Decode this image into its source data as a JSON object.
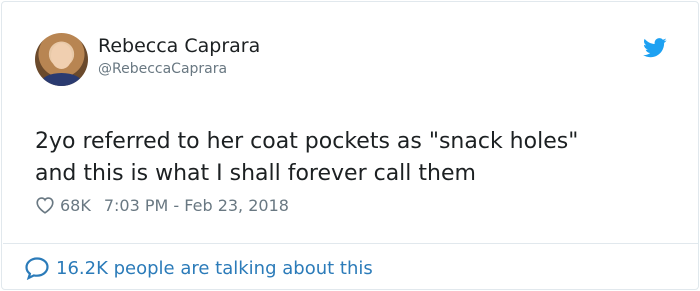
{
  "tweet": {
    "author": {
      "name": "Rebecca Caprara",
      "handle": "@RebeccaCaprara",
      "avatar_icon": "profile-photo"
    },
    "brand_icon": "twitter-bird-icon",
    "brand_color": "#1da1f2",
    "text_lines": [
      "2yo referred to her coat pockets as \"snack holes\"",
      "and this is what I shall forever call them"
    ],
    "likes": "68K",
    "timestamp": "7:03 PM - Feb 23, 2018",
    "footer_link": "16.2K people are talking about this",
    "link_color": "#2b7bb9",
    "meta_color": "#697882"
  }
}
